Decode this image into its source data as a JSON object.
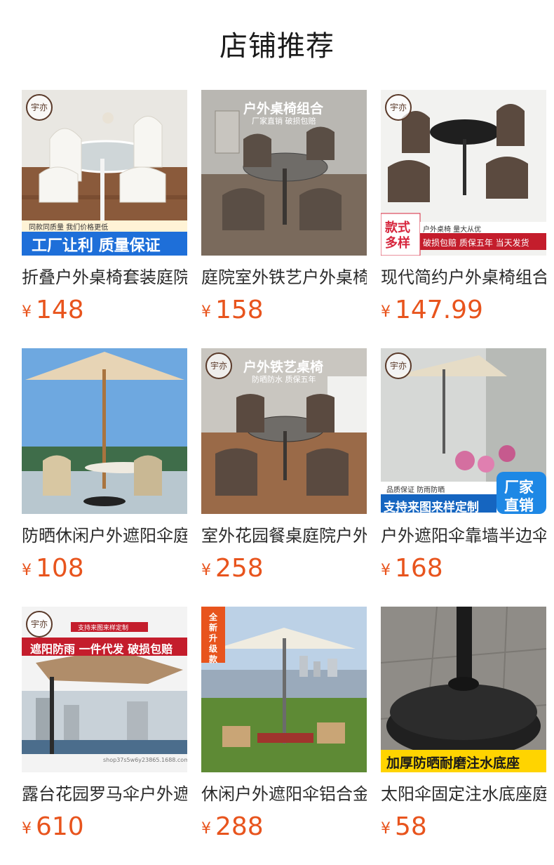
{
  "page": {
    "title": "店铺推荐"
  },
  "colors": {
    "price": "#e8541d",
    "accent_red": "#d7263d",
    "accent_blue": "#1565c0"
  },
  "products": [
    {
      "title": "折叠户外桌椅套装庭院",
      "currency": "¥",
      "price": "148",
      "badges": {
        "logo": "宇亦",
        "strip_small": "同款同质量 我们价格更低",
        "strip_big": "工厂让利 质量保证"
      }
    },
    {
      "title": "庭院室外铁艺户外桌椅",
      "currency": "¥",
      "price": "158",
      "badges": {
        "headline": "户外桌椅组合",
        "subline": "厂家直销  破损包赔"
      }
    },
    {
      "title": "现代简约户外桌椅组合",
      "currency": "¥",
      "price": "147.99",
      "badges": {
        "logo": "宇亦",
        "tag_left_1": "款式",
        "tag_left_2": "多样",
        "line1": "户外桌椅 量大从优",
        "line2": "破损包赔 质保五年 当天发货"
      }
    },
    {
      "title": "防晒休闲户外遮阳伞庭院",
      "currency": "¥",
      "price": "108",
      "badges": {}
    },
    {
      "title": "室外花园餐桌庭院户外桌",
      "currency": "¥",
      "price": "258",
      "badges": {
        "logo": "宇亦",
        "headline": "户外铁艺桌椅",
        "subline": "防晒防水 质保五年"
      }
    },
    {
      "title": "户外遮阳伞靠墙半边伞",
      "currency": "¥",
      "price": "168",
      "badges": {
        "logo": "宇亦",
        "small": "品质保证  防雨防晒",
        "big": "支持来图来样定制",
        "corner_1": "厂家",
        "corner_2": "直销"
      }
    },
    {
      "title": "露台花园罗马伞户外遮阳",
      "currency": "¥",
      "price": "610",
      "badges": {
        "logo": "宇亦",
        "small": "支持来图来样定制",
        "big": "遮阳防雨 一件代发 破损包赔",
        "watermark": "shop37s5w6y23865.1688.com"
      }
    },
    {
      "title": "休闲户外遮阳伞铝合金",
      "currency": "¥",
      "price": "288",
      "badges": {
        "ribbon": "全新升级款"
      }
    },
    {
      "title": "太阳伞固定注水底座庭院",
      "currency": "¥",
      "price": "58",
      "badges": {
        "strip": "加厚防晒耐磨注水底座"
      }
    }
  ]
}
